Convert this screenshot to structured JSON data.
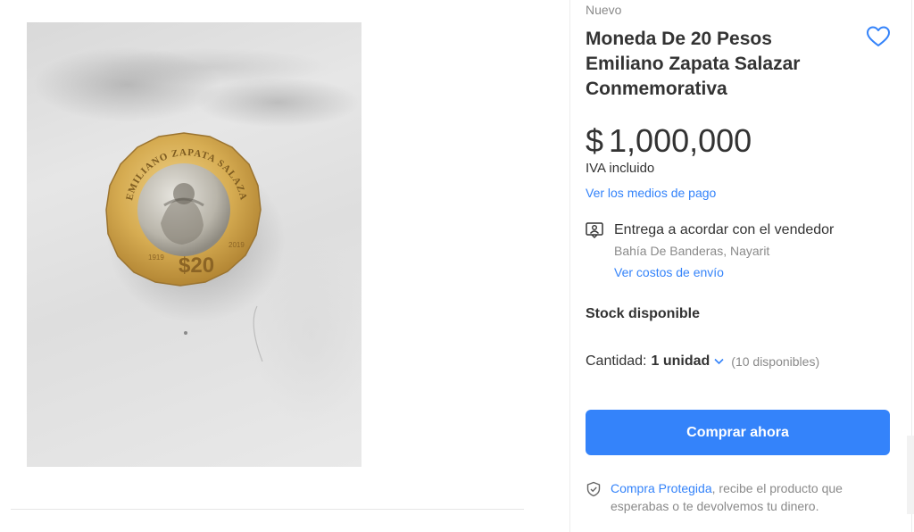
{
  "product": {
    "condition": "Nuevo",
    "title": "Moneda De 20 Pesos Emiliano Zapata Salazar Conmemorativa",
    "currency_symbol": "$",
    "price": "1,000,000",
    "tax_note": "IVA incluido",
    "payment_link": "Ver los medios de pago"
  },
  "shipping": {
    "icon": "handshake-user-icon",
    "title": "Entrega a acordar con el vendedor",
    "location": "Bahía De Banderas, Nayarit",
    "cost_link": "Ver costos de envío"
  },
  "stock": {
    "label": "Stock disponible",
    "quantity_label": "Cantidad:",
    "quantity_value": "1 unidad",
    "available": "(10 disponibles)"
  },
  "actions": {
    "buy_label": "Comprar ahora",
    "favorite_icon": "heart-icon"
  },
  "protection": {
    "link": "Compra Protegida",
    "text": ", recibe el producto que esperabas o te devolvemos tu dinero."
  },
  "image": {
    "coin_text_top": "EMILIANO ZAPATA SALAZAR",
    "coin_value": "$20",
    "coin_year_left": "1919",
    "coin_year_right": "2019"
  },
  "colors": {
    "accent": "#3483fa",
    "text": "#333333",
    "muted": "#8a8a8a"
  }
}
